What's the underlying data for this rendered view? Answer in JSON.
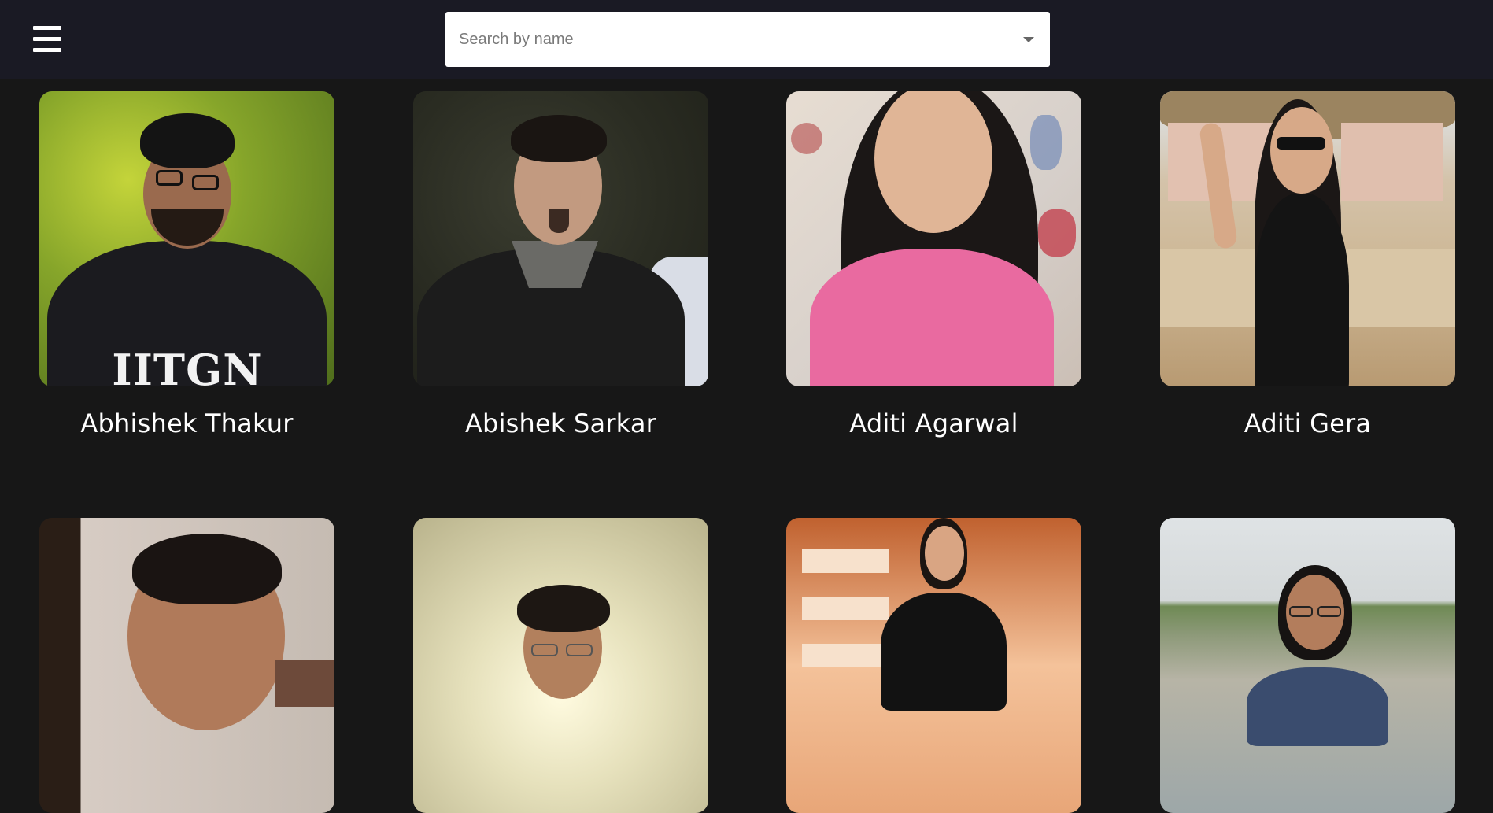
{
  "header": {
    "menu_icon": "hamburger-menu-icon",
    "search": {
      "placeholder": "Search by name",
      "dropdown_icon": "caret-down-icon"
    },
    "bg_color": "#1a1a24"
  },
  "page": {
    "bg_color": "#171717",
    "text_color": "#ffffff"
  },
  "people": [
    {
      "name": "Abhishek Thakur",
      "photo_bg": "#7f9a2a",
      "shirt_text": "IITGN"
    },
    {
      "name": "Abishek Sarkar",
      "photo_bg": "#2c2c24"
    },
    {
      "name": "Aditi Agarwal",
      "photo_bg": "#d8cfc6"
    },
    {
      "name": "Aditi Gera",
      "photo_bg": "#c9b49a"
    },
    {
      "name": "",
      "photo_bg": "#c9bfb6"
    },
    {
      "name": "",
      "photo_bg": "#e8e2bc"
    },
    {
      "name": "",
      "photo_bg": "#f0b48a"
    },
    {
      "name": "",
      "photo_bg": "#b8c2c0"
    }
  ]
}
